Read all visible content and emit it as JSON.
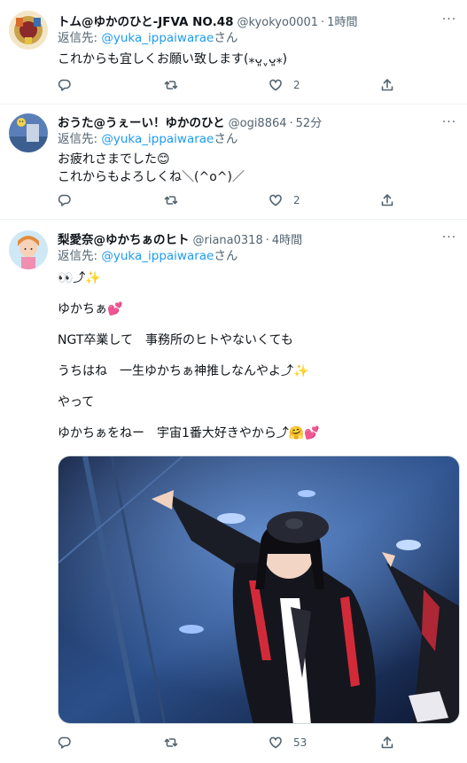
{
  "tweets": [
    {
      "name": "トム@ゆかのひと-JFVA NO.48",
      "handle": "@kyokyo0001",
      "sep": "·",
      "time": "1時間",
      "reply_prefix": "返信先: ",
      "reply_to": "@yuka_ippaiwarae",
      "reply_suffix": "さん",
      "lines": [
        "これからも宜しくお願い致します(⁎ᴗ͈ˬᴗ͈⁎)"
      ],
      "likes": "2",
      "more": "···"
    },
    {
      "name": "おうた@うぇーい！ゆかのひと",
      "handle": "@ogi8864",
      "sep": "·",
      "time": "52分",
      "reply_prefix": "返信先: ",
      "reply_to": "@yuka_ippaiwarae",
      "reply_suffix": "さん",
      "lines": [
        "お疲れさまでした😊",
        "これからもよろしくね＼(^o^)／"
      ],
      "likes": "2",
      "more": "···"
    },
    {
      "name": "梨愛奈@ゆかちぁのヒト",
      "handle": "@riana0318",
      "sep": "·",
      "time": "4時間",
      "reply_prefix": "返信先: ",
      "reply_to": "@yuka_ippaiwarae",
      "reply_suffix": "さん",
      "lines": [
        "👀⤴✨",
        "",
        "ゆかちぁ💕",
        "",
        "NGT卒業して　事務所のヒトやないくても",
        "",
        "うちはね　一生ゆかちぁ神推しなんやよ⤴✨",
        "",
        "やって",
        "",
        "ゆかちぁをねー　宇宙1番大好きやから⤴🤗💕"
      ],
      "likes": "53",
      "more": "···"
    }
  ],
  "icons": [
    "reply-icon",
    "retweet-icon",
    "like-icon",
    "share-icon",
    "more-icon"
  ],
  "colors": {
    "accent": "#1d9bf0",
    "secondary_text": "#536471",
    "divider": "#eff3f4"
  }
}
